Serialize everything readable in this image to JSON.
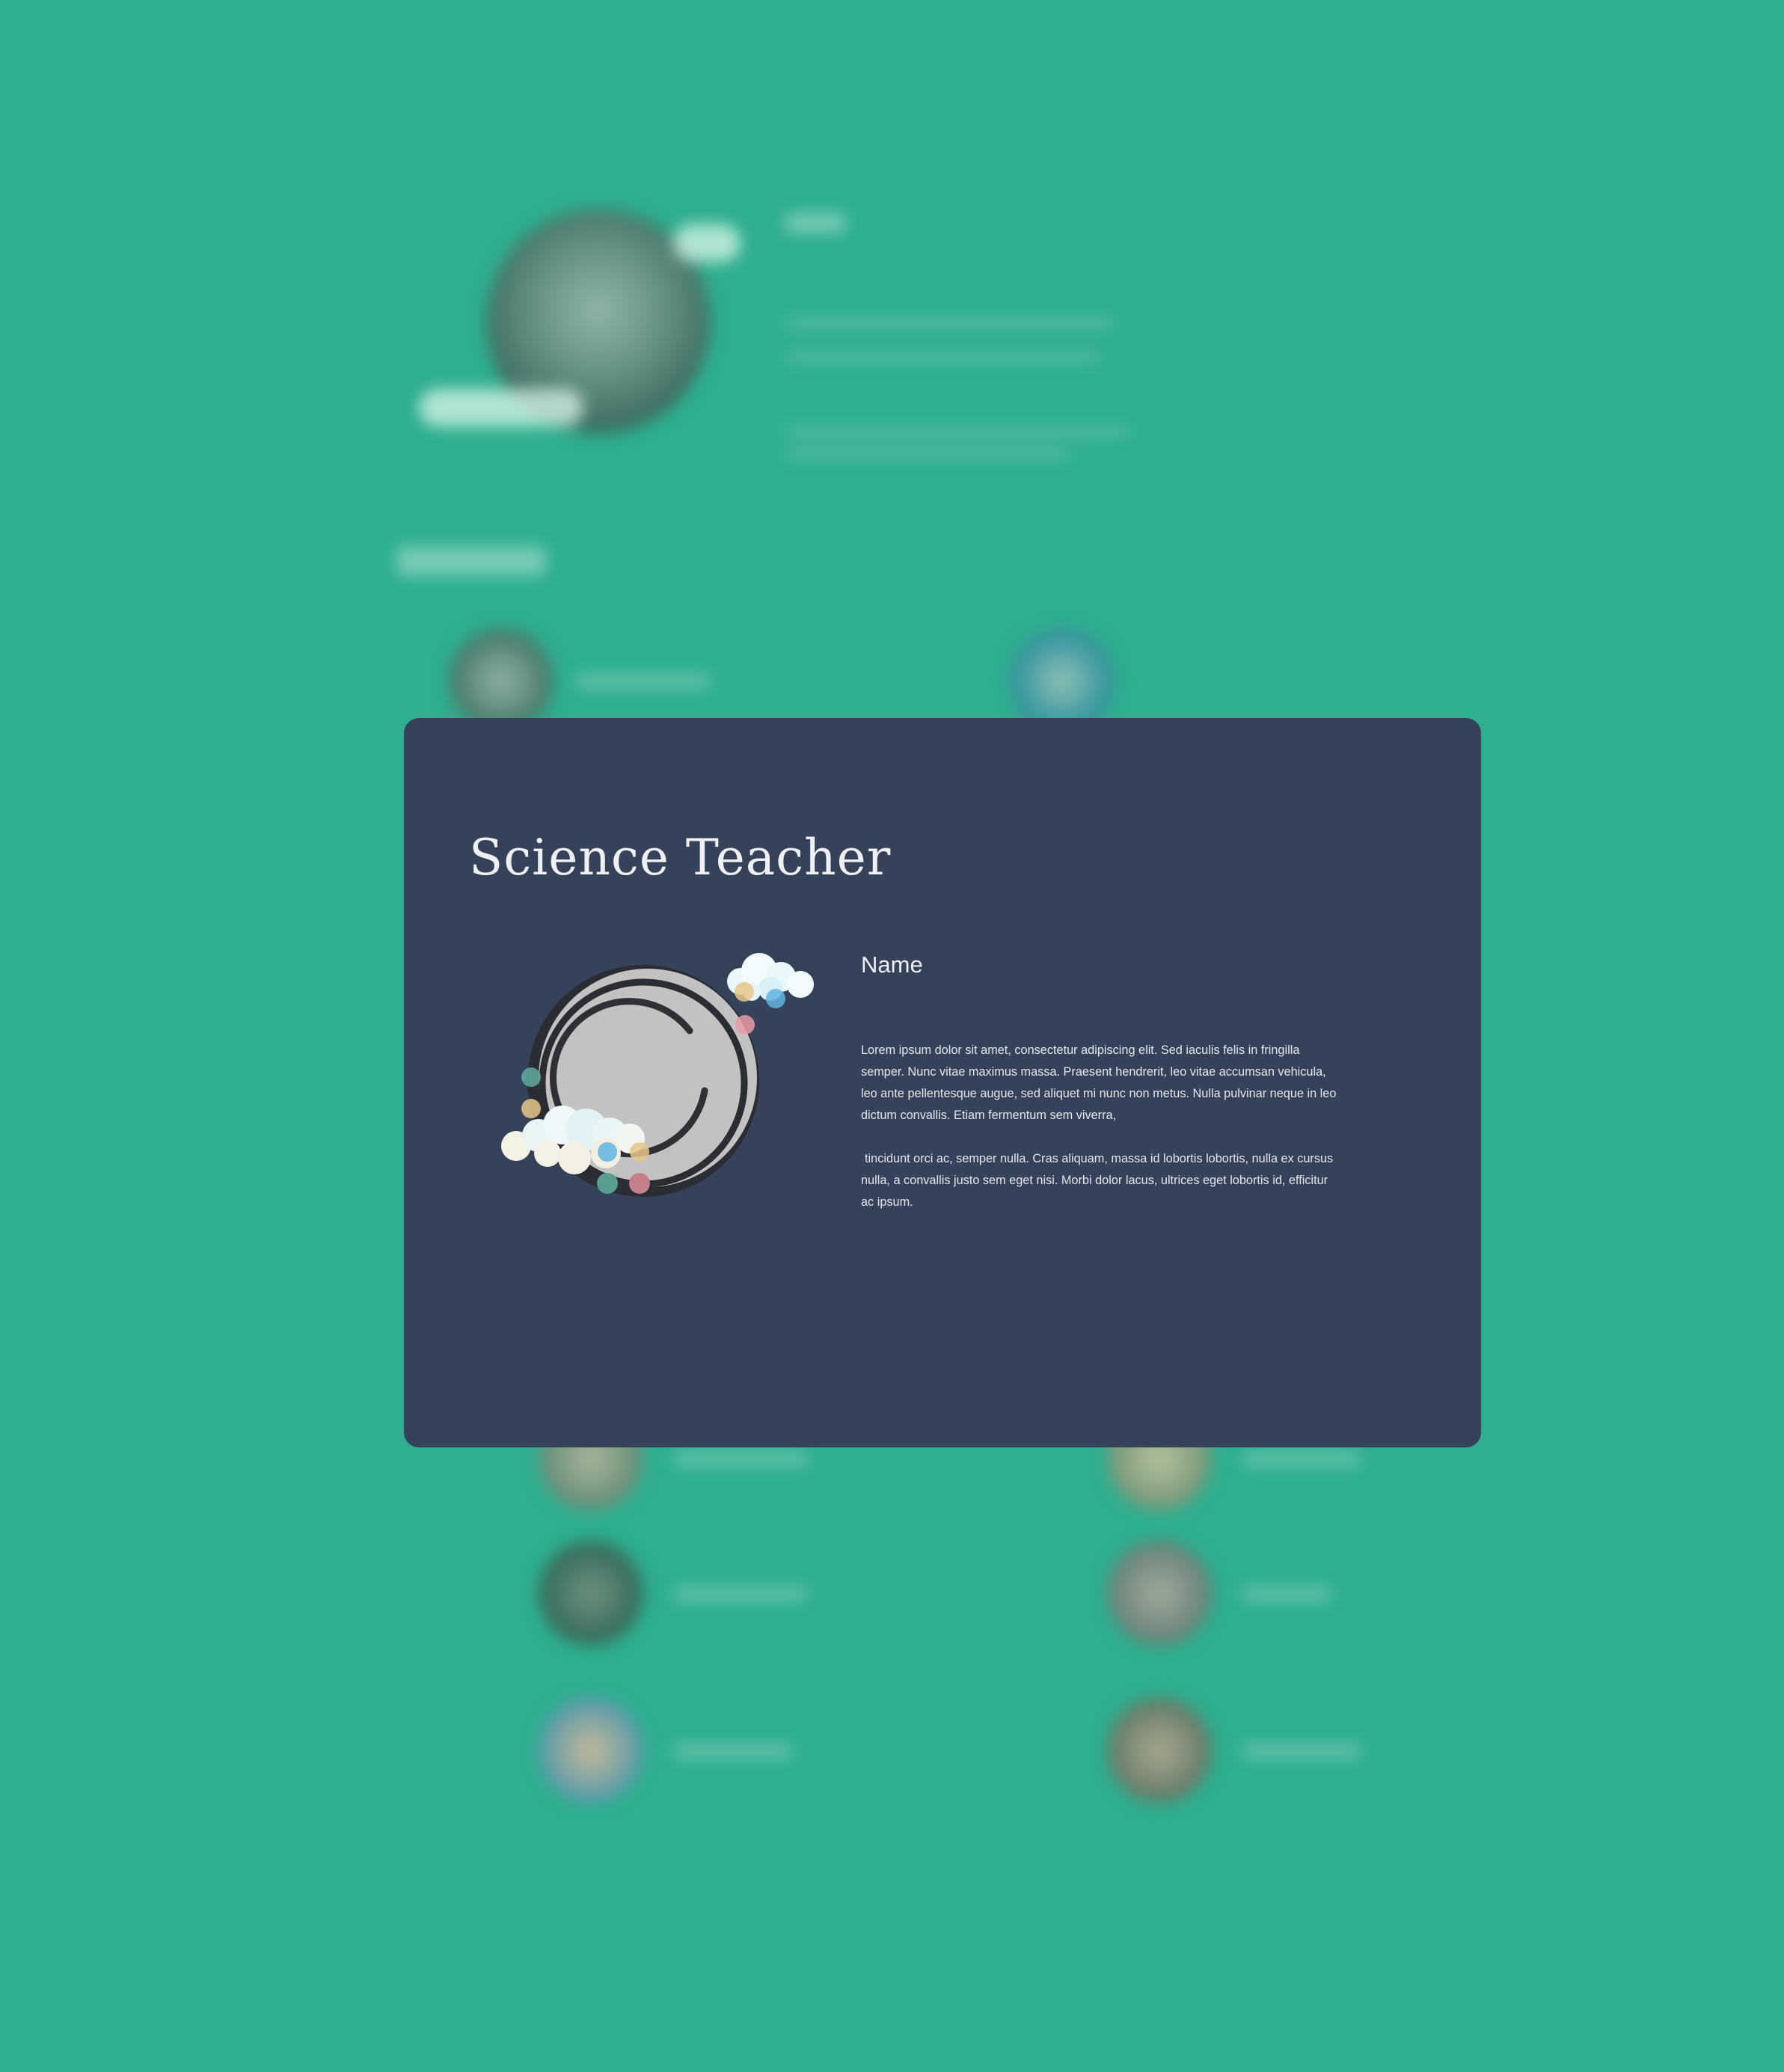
{
  "modal": {
    "title": "Science Teacher",
    "name": "Name",
    "bio_paragraphs": [
      "Lorem ipsum dolor sit amet, consectetur adipiscing elit. Sed iaculis felis in fringilla semper. Nunc vitae maximus massa. Praesent hendrerit, leo vitae accumsan vehicula, leo ante pellentesque augue, sed aliquet mi nunc non metus. Nulla pulvinar neque in leo dictum convallis. Etiam fermentum sem viverra,",
      "tincidunt orci ac, semper nulla. Cras aliquam, massa id lobortis lobortis, nulla ex cursus nulla, a convallis justo sem eget nisi. Morbi dolor lacus, ultrices eget lobortis id, efficitur ac ipsum."
    ]
  },
  "colors": {
    "page_background": "#2eae8f",
    "modal_background": "#36425a",
    "text": "#eef0f3"
  },
  "icons": [
    "portrait-placeholder-icon",
    "cloud-icon"
  ]
}
